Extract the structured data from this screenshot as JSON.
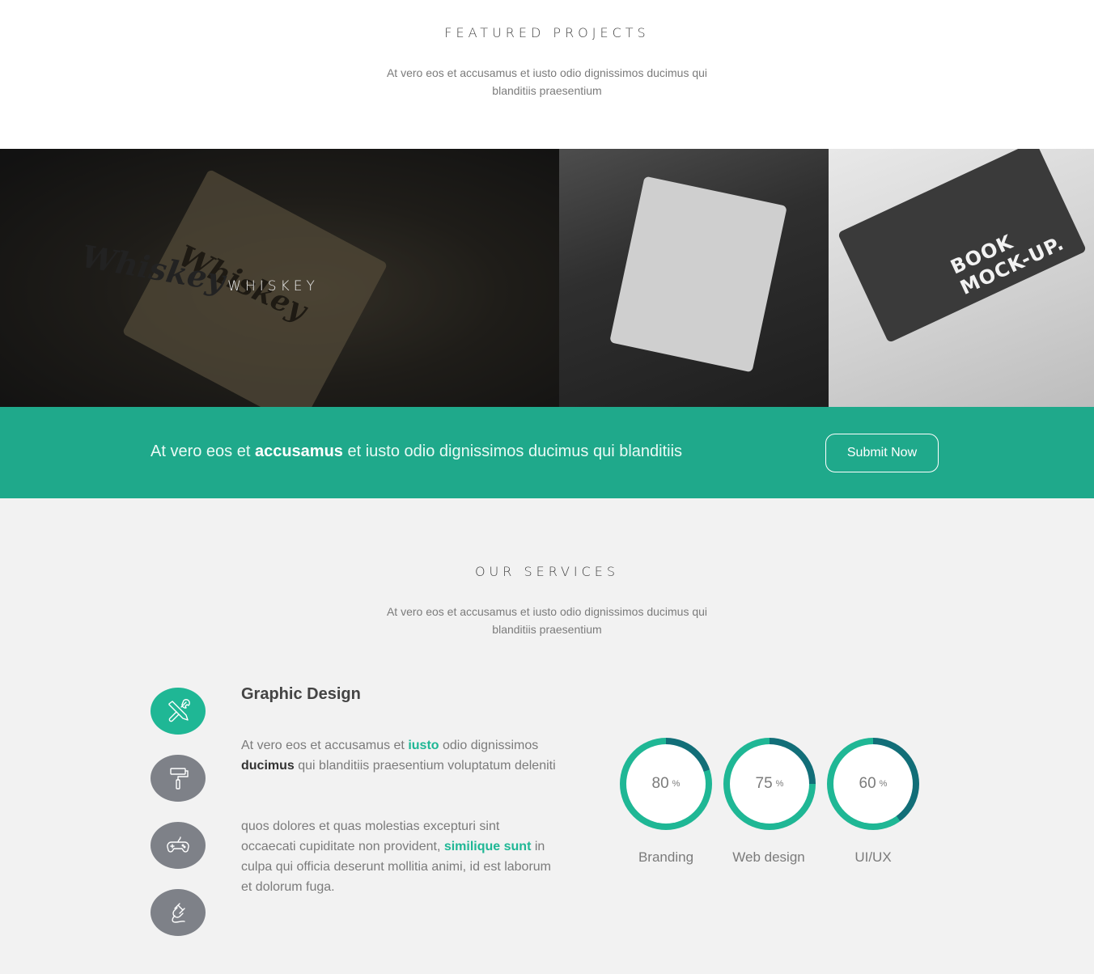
{
  "featured": {
    "title": "FEATURED PROJECTS",
    "subtitle": "At vero eos et accusamus et iusto odio dignissimos ducimus qui blanditiis praesentium"
  },
  "gallery": {
    "items": [
      {
        "label": "WHISKEY",
        "tag_text": "Whiskey"
      },
      {
        "tag_text": "Whiskey"
      },
      {
        "tag_text": "BOOK MOCK-UP."
      }
    ]
  },
  "cta": {
    "text_before": "At vero eos et ",
    "text_bold": "accusamus",
    "text_after": " et iusto odio dignissimos ducimus qui blanditiis",
    "button_label": "Submit Now",
    "color": "#1fa98b"
  },
  "services": {
    "title": "OUR SERVICES",
    "subtitle": "At vero eos et accusamus et iusto odio dignissimos ducimus qui blanditiis praesentium",
    "icons": [
      "tools-icon",
      "paint-roller-icon",
      "gamepad-icon",
      "plug-icon"
    ],
    "detail": {
      "title": "Graphic Design",
      "p1_a": "At vero eos et accusamus et ",
      "p1_hl": "iusto",
      "p1_b": " odio dignissimos ",
      "p1_dark": "ducimus",
      "p1_c": " qui blanditiis praesentium voluptatum deleniti",
      "p2_a": "quos dolores et quas molestias excepturi sint occaecati cupiditate non provident, ",
      "p2_hl": "similique sunt",
      "p2_b": " in culpa qui officia deserunt mollitia animi, id est laborum et dolorum fuga."
    },
    "skills": [
      {
        "value": 80,
        "value_text": "80",
        "unit": "%",
        "label": "Branding"
      },
      {
        "value": 75,
        "value_text": "75",
        "unit": "%",
        "label": "Web design"
      },
      {
        "value": 60,
        "value_text": "60",
        "unit": "%",
        "label": "UI/UX"
      }
    ],
    "colors": {
      "accent": "#1fb795",
      "accent_dark": "#126e78",
      "icon_idle": "#7e8188"
    }
  }
}
